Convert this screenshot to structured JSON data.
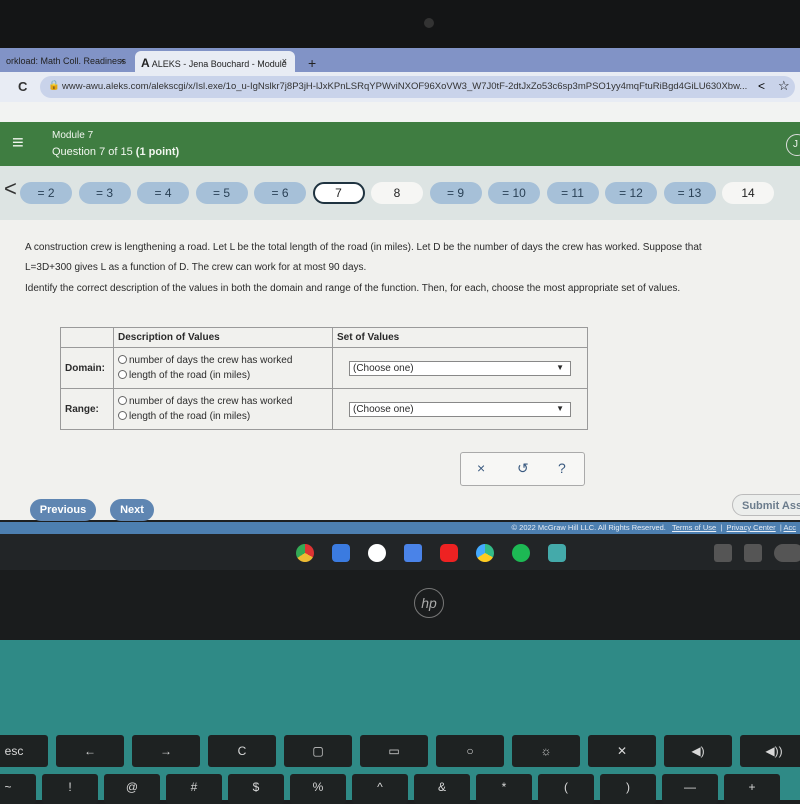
{
  "browser": {
    "tabs": [
      {
        "label": "orkload: Math Coll. Readiness"
      },
      {
        "label": "ALEKS - Jena Bouchard - Module"
      }
    ],
    "tab_close": "×",
    "new_tab": "+",
    "url": "www-awu.aleks.com/alekscgi/x/Isl.exe/1o_u-IgNslkr7j8P3jH-lJxKPnLSRqYPWviNXOF96XoVW3_W7J0tF-2dtJxZo53c6sp3mPSO1yy4mqFtuRiBgd4GiLU630Xbw...",
    "reload": "C"
  },
  "header": {
    "module": "Module 7",
    "question": "Question 7 of 15",
    "points": "(1 point)",
    "menu_icon": "hamburger-icon",
    "user_initial": "J"
  },
  "nav": {
    "questions": [
      {
        "label": "2",
        "state": "done"
      },
      {
        "label": "3",
        "state": "done"
      },
      {
        "label": "4",
        "state": "done"
      },
      {
        "label": "5",
        "state": "done"
      },
      {
        "label": "6",
        "state": "done"
      },
      {
        "label": "7",
        "state": "current"
      },
      {
        "label": "8",
        "state": "unvisited"
      },
      {
        "label": "9",
        "state": "done"
      },
      {
        "label": "10",
        "state": "done"
      },
      {
        "label": "11",
        "state": "done"
      },
      {
        "label": "12",
        "state": "done"
      },
      {
        "label": "13",
        "state": "done"
      },
      {
        "label": "14",
        "state": "unvisited"
      }
    ],
    "done_mark": "="
  },
  "problem": {
    "line1": "A construction crew is lengthening a road. Let L be the total length of the road (in miles). Let D be the number of days the crew has worked. Suppose that",
    "line2": "L=3D+300 gives L as a function of D. The crew can work for at most 90 days.",
    "instruction": "Identify the correct description of the values in both the domain and range of the function. Then, for each, choose the most appropriate set of values."
  },
  "table": {
    "headers": [
      "",
      "Description of Values",
      "Set of Values"
    ],
    "rows": [
      {
        "label": "Domain:",
        "options": [
          "number of days the crew has worked",
          "length of the road (in miles)"
        ],
        "select": "(Choose one)"
      },
      {
        "label": "Range:",
        "options": [
          "number of days the crew has worked",
          "length of the road (in miles)"
        ],
        "select": "(Choose one)"
      }
    ]
  },
  "actions": {
    "clear": "×",
    "undo": "↺",
    "help": "?"
  },
  "buttons": {
    "previous": "Previous",
    "next": "Next",
    "submit": "Submit Assig"
  },
  "footer": {
    "copyright": "© 2022 McGraw Hill LLC. All Rights Reserved.",
    "terms": "Terms of Use",
    "privacy": "Privacy Center",
    "access": "Acc"
  },
  "laptop": {
    "brand": "hp"
  },
  "keyboard": {
    "row1": [
      "esc",
      "←",
      "→",
      "C",
      "▢",
      "▭",
      "○",
      "☼",
      "✕",
      "◀)",
      "◀))"
    ],
    "row2": [
      "~",
      "!",
      "@",
      "#",
      "$",
      "%",
      "^",
      "&",
      "*",
      "(",
      ")",
      "—",
      "+"
    ]
  }
}
